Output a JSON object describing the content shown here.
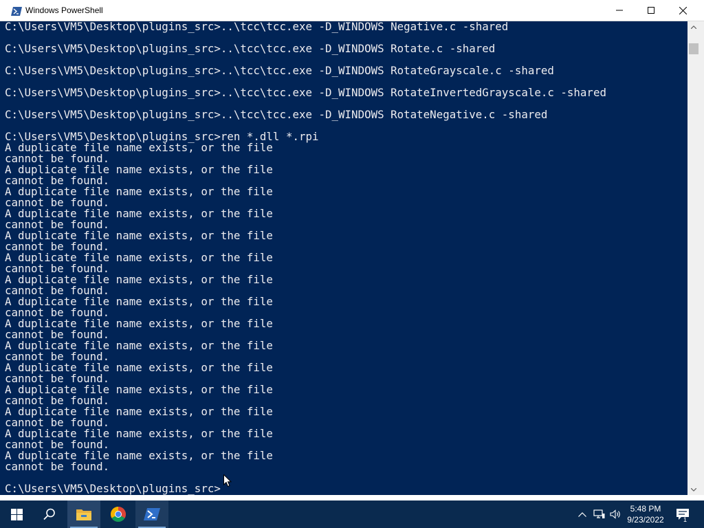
{
  "window": {
    "title": "Windows PowerShell"
  },
  "console": {
    "lines": [
      "C:\\Users\\VM5\\Desktop\\plugins_src>..\\tcc\\tcc.exe -D_WINDOWS Negative.c -shared",
      "",
      "C:\\Users\\VM5\\Desktop\\plugins_src>..\\tcc\\tcc.exe -D_WINDOWS Rotate.c -shared",
      "",
      "C:\\Users\\VM5\\Desktop\\plugins_src>..\\tcc\\tcc.exe -D_WINDOWS RotateGrayscale.c -shared",
      "",
      "C:\\Users\\VM5\\Desktop\\plugins_src>..\\tcc\\tcc.exe -D_WINDOWS RotateInvertedGrayscale.c -shared",
      "",
      "C:\\Users\\VM5\\Desktop\\plugins_src>..\\tcc\\tcc.exe -D_WINDOWS RotateNegative.c -shared",
      "",
      "C:\\Users\\VM5\\Desktop\\plugins_src>ren *.dll *.rpi",
      "A duplicate file name exists, or the file",
      "cannot be found.",
      "A duplicate file name exists, or the file",
      "cannot be found.",
      "A duplicate file name exists, or the file",
      "cannot be found.",
      "A duplicate file name exists, or the file",
      "cannot be found.",
      "A duplicate file name exists, or the file",
      "cannot be found.",
      "A duplicate file name exists, or the file",
      "cannot be found.",
      "A duplicate file name exists, or the file",
      "cannot be found.",
      "A duplicate file name exists, or the file",
      "cannot be found.",
      "A duplicate file name exists, or the file",
      "cannot be found.",
      "A duplicate file name exists, or the file",
      "cannot be found.",
      "A duplicate file name exists, or the file",
      "cannot be found.",
      "A duplicate file name exists, or the file",
      "cannot be found.",
      "A duplicate file name exists, or the file",
      "cannot be found.",
      "A duplicate file name exists, or the file",
      "cannot be found.",
      "A duplicate file name exists, or the file",
      "cannot be found.",
      "",
      "C:\\Users\\VM5\\Desktop\\plugins_src>"
    ],
    "colors": {
      "background": "#012456",
      "text": "#eeedf0"
    }
  },
  "taskbar": {
    "apps": [
      "start-icon",
      "search-icon",
      "file-explorer-icon",
      "chrome-icon",
      "powershell-icon"
    ],
    "clock": {
      "time": "5:48 PM",
      "date": "9/23/2022"
    },
    "notification_count": "1"
  }
}
